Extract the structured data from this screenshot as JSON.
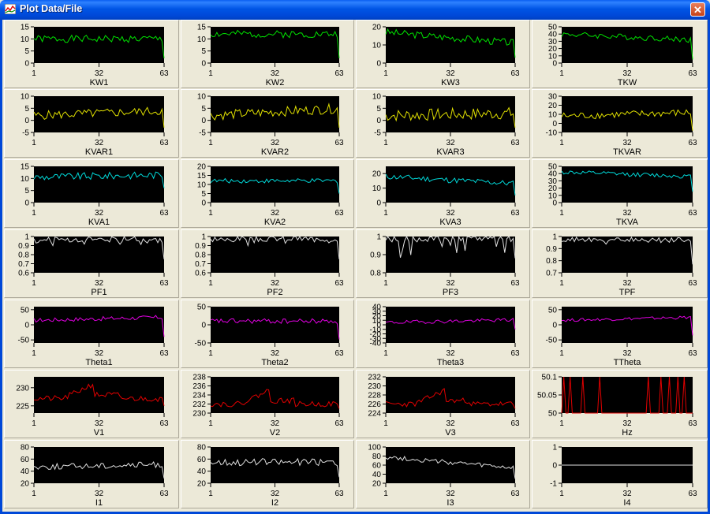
{
  "window": {
    "title": "Plot Data/File",
    "close_glyph": "✕"
  },
  "plot_style": {
    "background": "#000000",
    "axis_color": "#000000"
  },
  "x_ticks": [
    1,
    32,
    63
  ],
  "chart_data": [
    {
      "type": "line",
      "ylabel": "KW1",
      "color": "#00e000",
      "y_ticks": [
        0,
        5,
        10,
        15
      ],
      "ylim": [
        0,
        15
      ],
      "base": 10,
      "amp": 1.5,
      "seed": 1,
      "end": 2,
      "values": []
    },
    {
      "type": "line",
      "ylabel": "KW2",
      "color": "#00e000",
      "y_ticks": [
        0,
        5,
        10,
        15
      ],
      "ylim": [
        0,
        15
      ],
      "base": 12,
      "amp": 1.5,
      "seed": 2,
      "end": 2,
      "values": []
    },
    {
      "type": "line",
      "ylabel": "KW3",
      "color": "#00e000",
      "y_ticks": [
        0,
        10,
        20
      ],
      "ylim": [
        0,
        20
      ],
      "base": 17,
      "amp": 2,
      "seed": 3,
      "trend": -6,
      "end": 3,
      "values": []
    },
    {
      "type": "line",
      "ylabel": "TKW",
      "color": "#00e000",
      "y_ticks": [
        0,
        10,
        20,
        30,
        40,
        50
      ],
      "ylim": [
        0,
        50
      ],
      "base": 40,
      "amp": 4,
      "seed": 4,
      "trend": -8,
      "end": 5,
      "values": []
    },
    {
      "type": "line",
      "ylabel": "KVAR1",
      "color": "#e0e000",
      "y_ticks": [
        -5,
        0,
        5,
        10
      ],
      "ylim": [
        -5,
        10
      ],
      "base": 2,
      "amp": 1.8,
      "seed": 5,
      "trend": 2,
      "end": -3,
      "values": []
    },
    {
      "type": "line",
      "ylabel": "KVAR2",
      "color": "#e0e000",
      "y_ticks": [
        -5,
        0,
        5,
        10
      ],
      "ylim": [
        -5,
        10
      ],
      "base": 2,
      "amp": 2,
      "seed": 6,
      "trend": 3,
      "end": -3,
      "values": []
    },
    {
      "type": "line",
      "ylabel": "KVAR3",
      "color": "#e0e000",
      "y_ticks": [
        -5,
        0,
        5,
        10
      ],
      "ylim": [
        -5,
        10
      ],
      "base": 2,
      "amp": 2.5,
      "seed": 7,
      "trend": 1,
      "end": -3,
      "values": []
    },
    {
      "type": "line",
      "ylabel": "TKVAR",
      "color": "#e0e000",
      "y_ticks": [
        -10,
        0,
        10,
        20,
        30
      ],
      "ylim": [
        -10,
        30
      ],
      "base": 8,
      "amp": 4,
      "seed": 8,
      "trend": 4,
      "end": -8,
      "values": []
    },
    {
      "type": "line",
      "ylabel": "KVA1",
      "color": "#00d8d8",
      "y_ticks": [
        0,
        5,
        10,
        15
      ],
      "ylim": [
        0,
        15
      ],
      "base": 10.5,
      "amp": 1.5,
      "seed": 9,
      "trend": 1,
      "end": 6,
      "values": []
    },
    {
      "type": "line",
      "ylabel": "KVA2",
      "color": "#00d8d8",
      "y_ticks": [
        0,
        5,
        10,
        15,
        20
      ],
      "ylim": [
        0,
        20
      ],
      "base": 12,
      "amp": 1.2,
      "seed": 10,
      "end": 5,
      "values": []
    },
    {
      "type": "line",
      "ylabel": "KVA3",
      "color": "#00d8d8",
      "y_ticks": [
        0,
        10,
        20
      ],
      "ylim": [
        0,
        25
      ],
      "base": 18,
      "amp": 2,
      "seed": 11,
      "trend": -5,
      "end": 5,
      "values": []
    },
    {
      "type": "line",
      "ylabel": "TKVA",
      "color": "#00d8d8",
      "y_ticks": [
        0,
        10,
        20,
        30,
        40,
        50
      ],
      "ylim": [
        0,
        50
      ],
      "base": 42,
      "amp": 3,
      "seed": 12,
      "trend": -6,
      "end": 15,
      "values": []
    },
    {
      "type": "line",
      "ylabel": "PF1",
      "color": "#e0e0e0",
      "y_ticks": [
        0.6,
        0.7,
        0.8,
        0.9,
        1
      ],
      "ylim": [
        0.6,
        1
      ],
      "base": 0.97,
      "amp": 0.03,
      "seed": 13,
      "dips": 0.05,
      "end": 0.75,
      "values": []
    },
    {
      "type": "line",
      "ylabel": "PF2",
      "color": "#e0e0e0",
      "y_ticks": [
        0.6,
        0.7,
        0.8,
        0.9,
        1
      ],
      "ylim": [
        0.6,
        1
      ],
      "base": 0.975,
      "amp": 0.03,
      "seed": 14,
      "dips": 0.05,
      "end": 0.75,
      "values": []
    },
    {
      "type": "line",
      "ylabel": "PF3",
      "color": "#e0e0e0",
      "y_ticks": [
        0.8,
        0.9,
        1
      ],
      "ylim": [
        0.8,
        1
      ],
      "base": 0.99,
      "amp": 0.02,
      "seed": 15,
      "dips": 0.1,
      "end": 0.88,
      "values": []
    },
    {
      "type": "line",
      "ylabel": "TPF",
      "color": "#e0e0e0",
      "y_ticks": [
        0.7,
        0.8,
        0.9,
        1
      ],
      "ylim": [
        0.7,
        1
      ],
      "base": 0.975,
      "amp": 0.02,
      "seed": 16,
      "dips": 0.03,
      "end": 0.77,
      "values": []
    },
    {
      "type": "line",
      "ylabel": "Theta1",
      "color": "#e000e0",
      "y_ticks": [
        -50,
        0,
        50
      ],
      "ylim": [
        -60,
        60
      ],
      "base": 15,
      "amp": 7,
      "seed": 17,
      "trend": 10,
      "end": -40,
      "values": []
    },
    {
      "type": "line",
      "ylabel": "Theta2",
      "color": "#e000e0",
      "y_ticks": [
        -50,
        0,
        50
      ],
      "ylim": [
        -50,
        50
      ],
      "base": 10,
      "amp": 7,
      "seed": 18,
      "end": -40,
      "values": []
    },
    {
      "type": "line",
      "ylabel": "Theta3",
      "color": "#e000e0",
      "y_ticks": [
        -40,
        -30,
        -20,
        -10,
        0,
        10,
        20,
        30,
        40
      ],
      "ylim": [
        -40,
        40
      ],
      "base": 5,
      "amp": 4,
      "seed": 19,
      "trend": 6,
      "end": -10,
      "values": []
    },
    {
      "type": "line",
      "ylabel": "TTheta",
      "color": "#e000e0",
      "y_ticks": [
        -50,
        0,
        50
      ],
      "ylim": [
        -60,
        60
      ],
      "base": 15,
      "amp": 5,
      "seed": 20,
      "trend": 10,
      "end": -35,
      "values": []
    },
    {
      "type": "line",
      "ylabel": "V1",
      "color": "#e00000",
      "y_ticks": [
        225,
        230
      ],
      "ylim": [
        223,
        233
      ],
      "base": 227,
      "amp": 0.8,
      "seed": 21,
      "bump": 4,
      "end": 225,
      "values": []
    },
    {
      "type": "line",
      "ylabel": "V2",
      "color": "#e00000",
      "y_ticks": [
        230,
        232,
        234,
        236,
        238
      ],
      "ylim": [
        230,
        238
      ],
      "base": 232,
      "amp": 0.6,
      "seed": 22,
      "bump": 3,
      "end": 231,
      "values": []
    },
    {
      "type": "line",
      "ylabel": "V3",
      "color": "#e00000",
      "y_ticks": [
        224,
        226,
        228,
        230,
        232
      ],
      "ylim": [
        224,
        232
      ],
      "base": 226,
      "amp": 0.6,
      "seed": 23,
      "bump": 3,
      "end": 225,
      "values": []
    },
    {
      "type": "line",
      "ylabel": "Hz",
      "color": "#e00000",
      "y_ticks": [
        50,
        50.05,
        50.1
      ],
      "ylim": [
        50,
        50.1
      ],
      "base": 50,
      "amp": 0,
      "seed": 24,
      "spikes": [
        1,
        4,
        10,
        18,
        41,
        47,
        51,
        55,
        58
      ],
      "end": 50,
      "values": []
    },
    {
      "type": "line",
      "ylabel": "I1",
      "color": "#e0e0e0",
      "y_ticks": [
        20,
        40,
        60,
        80
      ],
      "ylim": [
        20,
        80
      ],
      "base": 47,
      "amp": 5,
      "seed": 25,
      "trend": 4,
      "end": 28,
      "values": []
    },
    {
      "type": "line",
      "ylabel": "I2",
      "color": "#e0e0e0",
      "y_ticks": [
        20,
        40,
        60,
        80
      ],
      "ylim": [
        20,
        80
      ],
      "base": 55,
      "amp": 6,
      "seed": 26,
      "end": 30,
      "values": []
    },
    {
      "type": "line",
      "ylabel": "I3",
      "color": "#e0e0e0",
      "y_ticks": [
        20,
        40,
        60,
        80,
        100
      ],
      "ylim": [
        20,
        100
      ],
      "base": 78,
      "amp": 5,
      "seed": 27,
      "trend": -25,
      "end": 30,
      "values": []
    },
    {
      "type": "line",
      "ylabel": "I4",
      "color": "#e0e0e0",
      "y_ticks": [
        -1,
        0,
        1
      ],
      "ylim": [
        -1,
        1
      ],
      "base": 0,
      "amp": 0,
      "seed": 28,
      "end": 0,
      "values": []
    }
  ]
}
